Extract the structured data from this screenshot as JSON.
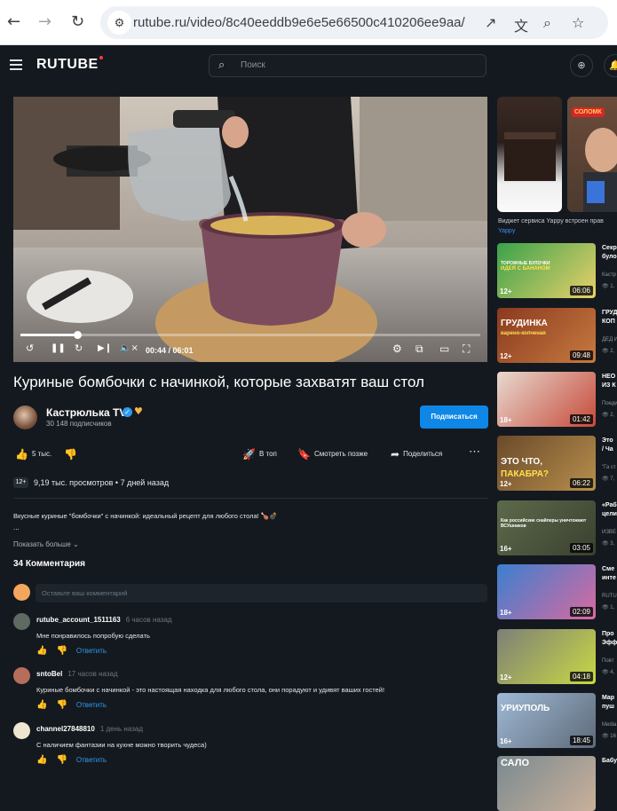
{
  "browser": {
    "url": "rutube.ru/video/8c40eeddb9e6e5e66500c410206ee9aa/",
    "back_icon": "←",
    "forward_icon": "→",
    "reload_icon": "↻",
    "site_icon": "⚙",
    "open_icon": "↗",
    "translate_icon": "文",
    "zoom_icon": "⌕",
    "star_icon": "☆"
  },
  "header": {
    "logo": "RUTUBE",
    "search_placeholder": "Поиск",
    "search_icon": "⌕",
    "upload_icon": "⊕"
  },
  "player": {
    "time": "00:44 / 06:01",
    "progress": 0.123,
    "replay_icon": "↺",
    "pause_icon": "❚❚",
    "forward_icon": "↻",
    "next_icon": "▶❙",
    "mute_icon": "🔈×",
    "settings_icon": "⚙",
    "miniplayer_icon": "⧉",
    "theater_icon": "▭",
    "fullscreen_icon": "⛶"
  },
  "video": {
    "title": "Куриные бомбочки с начинкой, которые захватят ваш стол",
    "channel": "Кастрюлька TV",
    "verified_icon": "✓",
    "heart_icon": "♥",
    "subscribers": "30 148 подписчиков",
    "subscribe_label": "Подписаться",
    "likes": "5 тыс.",
    "like_icon": "👍",
    "dislike_icon": "👎",
    "top_label": "В топ",
    "top_icon": "🚀",
    "later_label": "Смотреть позже",
    "later_icon": "🔖",
    "share_label": "Поделиться",
    "share_icon": "➦",
    "more_icon": "⋯",
    "age": "12+",
    "views": "9,19 тыс. просмотров",
    "uploaded": "7 дней назад",
    "description": "Вкусные куриные \"бомбочки\" с начинкой: идеальный рецепт для любого стола! 🍗💣",
    "description_more": "...",
    "show_more": "Показать больше ⌄"
  },
  "comments": {
    "heading": "34 Комментария",
    "placeholder": "Оставьте ваш комментарий",
    "reply_label": "Ответить",
    "up_icon": "👍",
    "down_icon": "👎",
    "items": [
      {
        "author": "rutube_account_1511163",
        "ago": "6 часов назад",
        "text": "Мне понравилось попробую сделать",
        "color": "#5e6a62"
      },
      {
        "author": "sntoBel",
        "ago": "17 часов назад",
        "text": "Куриные бомбочки с начинкой - это настоящая находка для любого стола, они порадуют и удивят ваших гостей!",
        "color": "#b56e5a"
      },
      {
        "author": "channel27848810",
        "ago": "1 день назад",
        "text": "С наличием фантазии на кухне можно творить чудеса)",
        "color": "#efe6cf"
      }
    ]
  },
  "sidebar": {
    "yappy_text": "Виджет сервиса Yappy встроен прав",
    "yappy_link": "Yappy",
    "yappy_badge": "СОЛОМК",
    "items": [
      {
        "title": "Секр",
        "title2": "було",
        "channel": "Кастр",
        "views": "1,",
        "age": "12+",
        "duration": "06:06",
        "caption": "ТОРОЖНЫЕ БУЛОЧКИ",
        "caption2": "ИДЕЯ С БАНАНОМ"
      },
      {
        "title": "ГРУД",
        "title2": "КОП",
        "channel": "ДЕД И",
        "views": "2,",
        "age": "12+",
        "duration": "09:48",
        "caption": "ГРУДИНКА",
        "caption2": "варено-копченая"
      },
      {
        "title": "НЕО",
        "title2": "ИЗ К",
        "channel": "Поеди",
        "views": "2,",
        "age": "18+",
        "duration": "01:42",
        "caption": "",
        "caption2": ""
      },
      {
        "title": "Это",
        "title2": "/ Ча",
        "channel": "\"Га ст",
        "views": "7,",
        "age": "12+",
        "duration": "06:22",
        "caption": "ЭТО ЧТО,",
        "caption2": "ПАКАБРА?"
      },
      {
        "title": "«Раб",
        "title2": "цели",
        "channel": "ИЗВЕ",
        "views": "3,",
        "age": "16+",
        "duration": "03:05",
        "caption": "Как российские снайперы уничтожают ВСУшников",
        "caption2": ""
      },
      {
        "title": "Сме",
        "title2": "инте",
        "channel": "RUTU",
        "views": "1,",
        "age": "18+",
        "duration": "02:09",
        "caption": "",
        "caption2": ""
      },
      {
        "title": "Про",
        "title2": "Эфф",
        "channel": "Повт",
        "views": "4,",
        "age": "12+",
        "duration": "04:18",
        "caption": "",
        "caption2": ""
      },
      {
        "title": "Мар",
        "title2": "пуш",
        "channel": "Media",
        "views": "16",
        "age": "16+",
        "duration": "18:45",
        "caption": "УРИУПОЛЬ",
        "caption2": ""
      },
      {
        "title": "Бабу",
        "title2": "",
        "channel": "",
        "views": "",
        "age": "",
        "duration": "",
        "caption": "САЛО",
        "caption2": ""
      }
    ]
  },
  "colors": {
    "background": "#14191f",
    "accent": "#0e87e6",
    "link": "#2e9bf0"
  }
}
